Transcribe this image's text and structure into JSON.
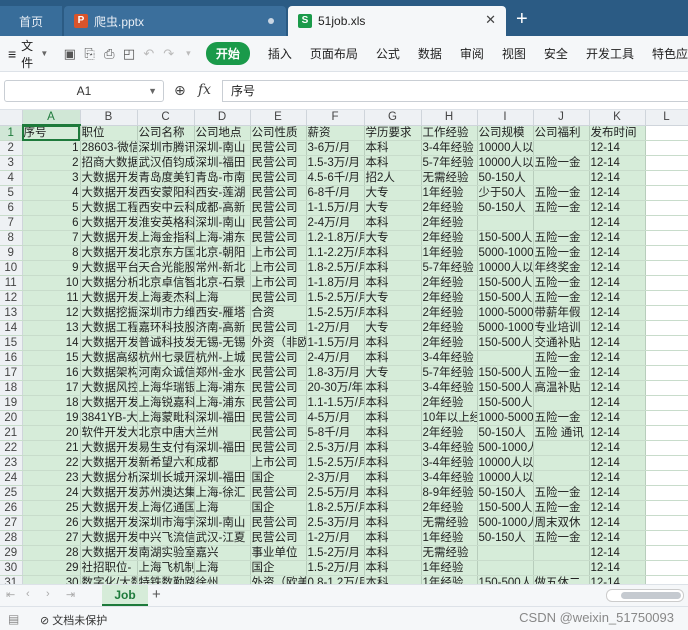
{
  "tabs": {
    "home": "首页",
    "pptx": "爬虫.pptx",
    "xls": "51job.xls",
    "new_tab": "+"
  },
  "ribbon": {
    "file_label": "文件",
    "items": [
      "开始",
      "插入",
      "页面布局",
      "公式",
      "数据",
      "审阅",
      "视图",
      "安全",
      "开发工具",
      "特色应"
    ]
  },
  "formula": {
    "cell_ref": "A1",
    "content": "序号",
    "fx": "fx"
  },
  "grid": {
    "columns": [
      "A",
      "B",
      "C",
      "D",
      "E",
      "F",
      "G",
      "H",
      "I",
      "J",
      "K",
      "L"
    ],
    "rows": [
      [
        "序号",
        "职位",
        "公司名称",
        "公司地点",
        "公司性质",
        "薪资",
        "学历要求",
        "工作经验",
        "公司规模",
        "公司福利",
        "发布时间",
        ""
      ],
      [
        "1",
        "28603-微信",
        "深圳市腾讯",
        "深圳-南山",
        "民营公司",
        "3-6万/月",
        "本科",
        "3-4年经验",
        "10000人以上",
        "",
        "12-14",
        ""
      ],
      [
        "2",
        "招商大数据",
        "武汉佰钧成",
        "深圳-福田",
        "民营公司",
        "1.5-3万/月",
        "本科",
        "5-7年经验",
        "10000人以上",
        "五险一金",
        "12-14",
        ""
      ],
      [
        "3",
        "大数据开发",
        "青岛度美钉",
        "青岛-市南",
        "民营公司",
        "4.5-6千/月",
        "招2人",
        "无需经验",
        "50-150人",
        "",
        "12-14",
        ""
      ],
      [
        "4",
        "大数据开发",
        "西安蒙阳科",
        "西安-莲湖",
        "民营公司",
        "6-8千/月",
        "大专",
        "1年经验",
        "少于50人",
        "五险一金",
        "12-14",
        ""
      ],
      [
        "5",
        "大数据工程",
        "西安中云科",
        "成都-高新",
        "民营公司",
        "1-1.5万/月",
        "大专",
        "2年经验",
        "50-150人",
        "五险一金",
        "12-14",
        ""
      ],
      [
        "6",
        "大数据开发",
        "淮安英格科",
        "深圳-南山",
        "民营公司",
        "2-4万/月",
        "本科",
        "2年经验",
        "",
        "",
        "12-14",
        ""
      ],
      [
        "7",
        "大数据开发",
        "上海金指科",
        "上海-浦东",
        "民营公司",
        "1.2-1.8万/月",
        "大专",
        "2年经验",
        "150-500人",
        "五险一金",
        "12-14",
        ""
      ],
      [
        "8",
        "大数据开发",
        "北京东方国",
        "北京-朝阳",
        "上市公司",
        "1.1-2.2万/月",
        "本科",
        "1年经验",
        "5000-10000人",
        "五险一金",
        "12-14",
        ""
      ],
      [
        "9",
        "大数据平台",
        "天合光能股",
        "常州-新北",
        "上市公司",
        "1.8-2.5万/月",
        "本科",
        "5-7年经验",
        "10000人以上",
        "年终奖金",
        "12-14",
        ""
      ],
      [
        "10",
        "大数据分析",
        "北京卓信智",
        "北京-石景",
        "上市公司",
        "1-1.8万/月",
        "本科",
        "2年经验",
        "150-500人",
        "五险一金",
        "12-14",
        ""
      ],
      [
        "11",
        "大数据开发",
        "上海麦杰科",
        "上海",
        "民营公司",
        "1.5-2.5万/月",
        "大专",
        "2年经验",
        "150-500人",
        "五险一金",
        "12-14",
        ""
      ],
      [
        "12",
        "大数据挖掘",
        "深圳市力维",
        "西安-雁塔",
        "合资",
        "1.5-2.5万/月",
        "本科",
        "2年经验",
        "1000-5000人",
        "带薪年假",
        "12-14",
        ""
      ],
      [
        "13",
        "大数据工程",
        "嘉环科技股",
        "济南-高新",
        "民营公司",
        "1-2万/月",
        "大专",
        "2年经验",
        "5000-10000人",
        "专业培训",
        "12-14",
        ""
      ],
      [
        "14",
        "大数据开发",
        "普诚科技发",
        "无锡-无锡",
        "外资（非欧美）",
        "1-1.5万/月",
        "本科",
        "2年经验",
        "150-500人",
        "交通补贴",
        "12-14",
        ""
      ],
      [
        "15",
        "大数据高级",
        "杭州七录匠",
        "杭州-上城",
        "民营公司",
        "2-4万/月",
        "本科",
        "3-4年经验",
        "",
        "五险一金",
        "12-14",
        ""
      ],
      [
        "16",
        "大数据架构",
        "河南众诚信",
        "郑州-金水",
        "民营公司",
        "1.8-3万/月",
        "大专",
        "5-7年经验",
        "150-500人",
        "五险一金",
        "12-14",
        ""
      ],
      [
        "17",
        "大数据风控",
        "上海华瑞银",
        "上海-浦东",
        "民营公司",
        "20-30万/年",
        "本科",
        "3-4年经验",
        "150-500人",
        "高温补贴",
        "12-14",
        ""
      ],
      [
        "18",
        "大数据开发",
        "上海锐嘉科",
        "上海-浦东",
        "民营公司",
        "1.1-1.5万/月",
        "本科",
        "2年经验",
        "150-500人",
        "",
        "12-14",
        ""
      ],
      [
        "19",
        "3841YB-大数",
        "上海蒙毗科",
        "深圳-福田",
        "民营公司",
        "4-5万/月",
        "本科",
        "10年以上经验",
        "1000-5000人",
        "五险一金",
        "12-14",
        ""
      ],
      [
        "20",
        "软件开发大",
        "北京中唐大",
        "兰州",
        "民营公司",
        "5-8千/月",
        "本科",
        "2年经验",
        "50-150人",
        "五险 通讯",
        "12-14",
        ""
      ],
      [
        "21",
        "大数据开发",
        "易生支付有",
        "深圳-福田",
        "民营公司",
        "2.5-3万/月",
        "本科",
        "3-4年经验",
        "500-1000人",
        "",
        "12-14",
        ""
      ],
      [
        "22",
        "大数据开发",
        "新希望六和",
        "成都",
        "上市公司",
        "1.5-2.5万/月",
        "本科",
        "3-4年经验",
        "10000人以上",
        "",
        "12-14",
        ""
      ],
      [
        "23",
        "大数据分析",
        "深圳长城开",
        "深圳-福田",
        "国企",
        "2-3万/月",
        "本科",
        "3-4年经验",
        "10000人以上",
        "",
        "12-14",
        ""
      ],
      [
        "24",
        "大数据开发",
        "苏州澳达集",
        "上海-徐汇",
        "民营公司",
        "2.5-5万/月",
        "本科",
        "8-9年经验",
        "50-150人",
        "五险一金",
        "12-14",
        ""
      ],
      [
        "25",
        "大数据开发",
        "上海亿通国",
        "上海",
        "国企",
        "1.8-2.5万/月",
        "本科",
        "2年经验",
        "150-500人",
        "五险一金",
        "12-14",
        ""
      ],
      [
        "26",
        "大数据开发",
        "深圳市海宇",
        "深圳-南山",
        "民营公司",
        "2.5-3万/月",
        "本科",
        "无需经验",
        "500-1000人",
        "周末双休",
        "12-14",
        ""
      ],
      [
        "27",
        "大数据开发",
        "中兴飞流信",
        "武汉-江夏",
        "民营公司",
        "1-2万/月",
        "本科",
        "1年经验",
        "50-150人",
        "五险一金",
        "12-14",
        ""
      ],
      [
        "28",
        "大数据开发",
        "南湖实验室",
        "嘉兴",
        "事业单位",
        "1.5-2万/月",
        "本科",
        "无需经验",
        "",
        "",
        "12-14",
        ""
      ],
      [
        "29",
        "社招职位-",
        "上海飞机制",
        "上海",
        "国企",
        "1.5-2万/月",
        "本科",
        "1年经验",
        "",
        "",
        "12-14",
        ""
      ],
      [
        "30",
        "数字化/大数",
        "特铁数勤路",
        "徐州",
        "外资（欧美）",
        "0.8-1.2万/月",
        "本科",
        "1年经验",
        "150-500人",
        "做五休二",
        "12-14",
        ""
      ],
      [
        "31",
        "大数据开发",
        "联想科技",
        "北京",
        "外资（非欧美）",
        "0.8-1.2万/月",
        "本科",
        "3-4年经验",
        "500-1000人",
        "五险一金",
        "12-14",
        ""
      ]
    ]
  },
  "sheets": {
    "active": "Job",
    "add": "+"
  },
  "status": {
    "protection": "文档未保护",
    "watermark": "CSDN @weixin_51750093"
  }
}
